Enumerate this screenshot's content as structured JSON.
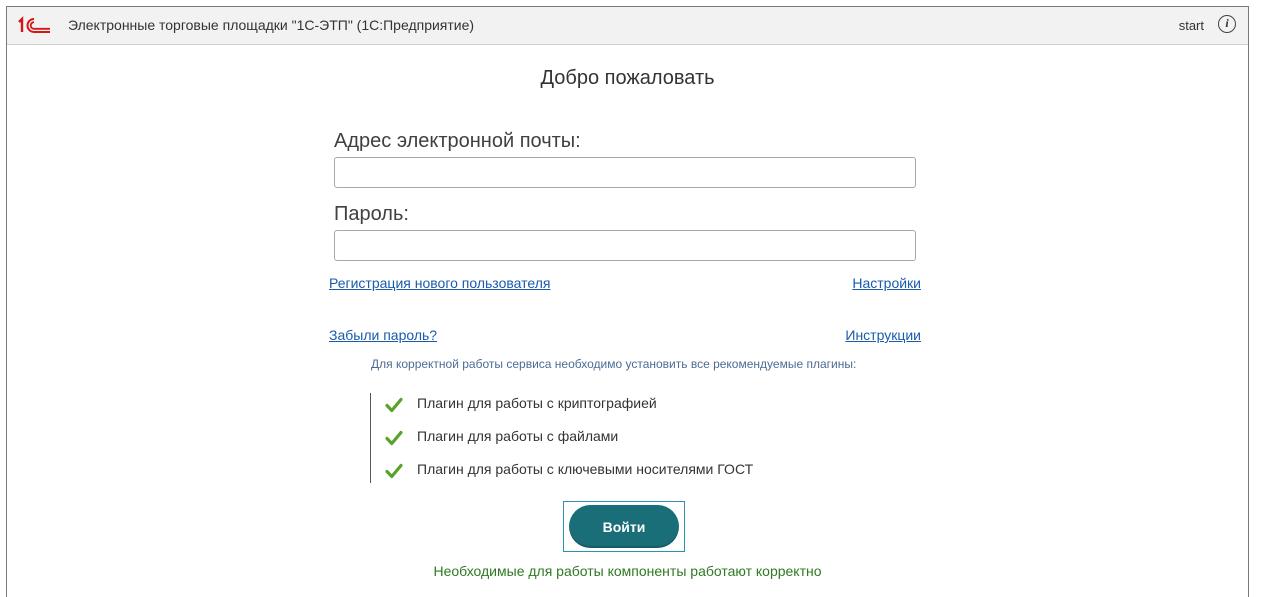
{
  "titlebar": {
    "app_title": "Электронные торговые площадки \"1С-ЭТП\"   (1С:Предприятие)",
    "user": "start",
    "info_icon": "info-icon"
  },
  "main": {
    "welcome": "Добро пожаловать",
    "email_label": "Адрес электронной почты:",
    "email_value": "",
    "password_label": "Пароль:",
    "password_value": "",
    "links": {
      "register": "Регистрация нового пользователя",
      "settings": "Настройки",
      "forgot_password": "Забыли пароль?",
      "instructions": "Инструкции"
    },
    "notice": "Для корректной работы сервиса необходимо установить все рекомендуемые плагины:",
    "plugins": [
      {
        "label": "Плагин для работы с криптографией",
        "status": "ok"
      },
      {
        "label": "Плагин для работы с файлами",
        "status": "ok"
      },
      {
        "label": "Плагин для работы с ключевыми носителями ГОСТ",
        "status": "ok"
      }
    ],
    "login_button": "Войти",
    "status_message": "Необходимые для работы компоненты работают корректно"
  },
  "colors": {
    "accent_button": "#1a6e78",
    "link": "#1a5bab",
    "check": "#5aa32a",
    "status_ok": "#2e7a22",
    "brand_red": "#d7141a"
  }
}
